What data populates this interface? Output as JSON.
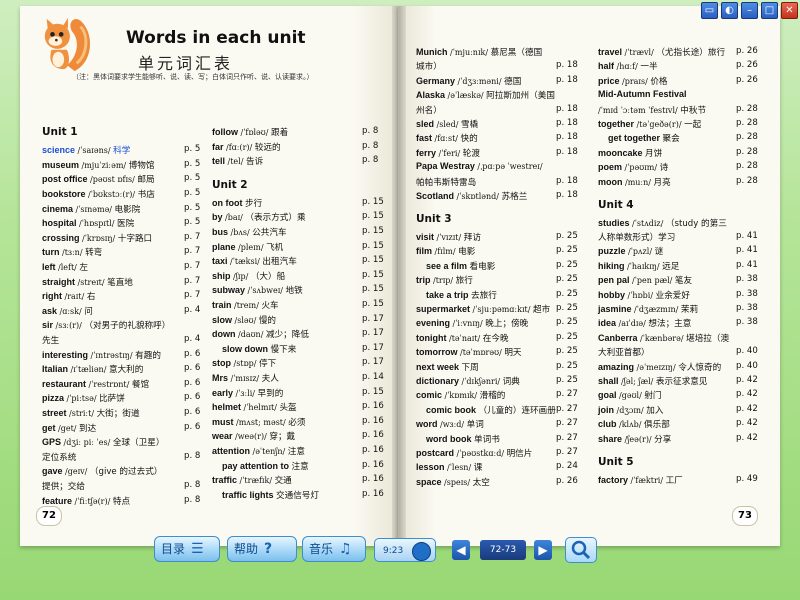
{
  "window_controls": [
    "▭",
    "◐",
    "–",
    "□",
    "✕"
  ],
  "book": {
    "title": "Words in each unit",
    "subtitle": "单元词汇表",
    "note": "（注：黑体词要求学生能够听、说、读、写；白体词只作听、说、认读要求。）",
    "page_left_number": "72",
    "page_right_number": "73"
  },
  "left_col1": [
    {
      "t": "unit",
      "en": "Unit 1"
    },
    {
      "en": "science",
      "ph": "/ˈsaɪəns/",
      "zh": "科学",
      "p": "p. 5",
      "blue": true
    },
    {
      "en": "museum",
      "ph": "/mjuˈziːəm/",
      "zh": "博物馆",
      "p": "p. 5"
    },
    {
      "en": "post office",
      "ph": "/pəʊst ɒfɪs/",
      "zh": "邮局",
      "p": "p. 5"
    },
    {
      "en": "bookstore",
      "ph": "/ˈbʊkstɔː(r)/",
      "zh": "书店",
      "p": "p. 5"
    },
    {
      "en": "cinema",
      "ph": "/ˈsɪnəmə/",
      "zh": "电影院",
      "p": "p. 5"
    },
    {
      "en": "hospital",
      "ph": "/ˈhɒspɪtl/",
      "zh": "医院",
      "p": "p. 5"
    },
    {
      "en": "crossing",
      "ph": "/ˈkrɒsɪŋ/",
      "zh": "十字路口",
      "p": "p. 7"
    },
    {
      "en": "turn",
      "ph": "/tɜːn/",
      "zh": "转弯",
      "p": "p. 7"
    },
    {
      "en": "left",
      "ph": "/left/",
      "zh": "左",
      "p": "p. 7"
    },
    {
      "en": "straight",
      "ph": "/streɪt/",
      "zh": "笔直地",
      "p": "p. 7"
    },
    {
      "en": "right",
      "ph": "/raɪt/",
      "zh": "右",
      "p": "p. 7"
    },
    {
      "en": "ask",
      "ph": "/ɑːsk/",
      "zh": "问",
      "p": "p. 4"
    },
    {
      "en": "sir",
      "ph": "/sɜː(r)/",
      "zh": "（对男子的礼貌称呼）",
      "p": ""
    },
    {
      "en": "",
      "ph": "",
      "zh": "先生",
      "p": "p. 4"
    },
    {
      "en": "interesting",
      "ph": "/ˈɪntrəstɪŋ/",
      "zh": "有趣的",
      "p": "p. 6"
    },
    {
      "en": "Italian",
      "ph": "/ɪˈtæliən/",
      "zh": "意大利的",
      "p": "p. 6"
    },
    {
      "en": "restaurant",
      "ph": "/ˈrestrɒnt/",
      "zh": "餐馆",
      "p": "p. 6"
    },
    {
      "en": "pizza",
      "ph": "/ˈpiːtsə/",
      "zh": "比萨饼",
      "p": "p. 6"
    },
    {
      "en": "street",
      "ph": "/striːt/",
      "zh": "大街；街道",
      "p": "p. 6"
    },
    {
      "en": "get",
      "ph": "/get/",
      "zh": "到达",
      "p": "p. 6"
    },
    {
      "en": "GPS",
      "ph": "/dʒiː piː ˈes/",
      "zh": "全球（卫星）",
      "p": ""
    },
    {
      "en": "",
      "ph": "",
      "zh": "定位系统",
      "p": "p. 8"
    },
    {
      "en": "gave",
      "ph": "/geɪv/",
      "zh": "（give 的过去式）",
      "p": ""
    },
    {
      "en": "",
      "ph": "",
      "zh": "提供；交给",
      "p": "p. 8"
    },
    {
      "en": "feature",
      "ph": "/ˈfiːtʃə(r)/",
      "zh": "特点",
      "p": "p. 8"
    }
  ],
  "left_col2": [
    {
      "en": "follow",
      "ph": "/ˈfɒləʊ/",
      "zh": "跟着",
      "p": "p. 8"
    },
    {
      "en": "far",
      "ph": "/fɑː(r)/",
      "zh": "较远的",
      "p": "p. 8"
    },
    {
      "en": "tell",
      "ph": "/tel/",
      "zh": "告诉",
      "p": "p. 8"
    },
    {
      "t": "gap"
    },
    {
      "t": "unit",
      "en": "Unit 2"
    },
    {
      "en": "on foot",
      "ph": "",
      "zh": "步行",
      "p": "p. 15"
    },
    {
      "en": "by",
      "ph": "/baɪ/",
      "zh": "（表示方式）乘",
      "p": "p. 15"
    },
    {
      "en": "bus",
      "ph": "/bʌs/",
      "zh": "公共汽车",
      "p": "p. 15"
    },
    {
      "en": "plane",
      "ph": "/pleɪn/",
      "zh": "飞机",
      "p": "p. 15"
    },
    {
      "en": "taxi",
      "ph": "/ˈtæksi/",
      "zh": "出租汽车",
      "p": "p. 15"
    },
    {
      "en": "ship",
      "ph": "/ʃɪp/",
      "zh": "（大）船",
      "p": "p. 15"
    },
    {
      "en": "subway",
      "ph": "/ˈsʌbweɪ/",
      "zh": "地铁",
      "p": "p. 15"
    },
    {
      "en": "train",
      "ph": "/treɪn/",
      "zh": "火车",
      "p": "p. 15"
    },
    {
      "en": "slow",
      "ph": "/sləʊ/",
      "zh": "慢的",
      "p": "p. 17"
    },
    {
      "en": "down",
      "ph": "/daʊn/",
      "zh": "减少；降低",
      "p": "p. 17"
    },
    {
      "en": "slow down",
      "ph": "",
      "zh": "慢下来",
      "p": "p. 17",
      "ind": true
    },
    {
      "en": "stop",
      "ph": "/stɒp/",
      "zh": "停下",
      "p": "p. 17"
    },
    {
      "en": "Mrs",
      "ph": "/ˈmɪsɪz/",
      "zh": "夫人",
      "p": "p. 14"
    },
    {
      "en": "early",
      "ph": "/ˈɜːli/",
      "zh": "早到的",
      "p": "p. 15"
    },
    {
      "en": "helmet",
      "ph": "/ˈhelmɪt/",
      "zh": "头盔",
      "p": "p. 16"
    },
    {
      "en": "must",
      "ph": "/mʌst; məst/",
      "zh": "必须",
      "p": "p. 16"
    },
    {
      "en": "wear",
      "ph": "/weə(r)/",
      "zh": "穿；戴",
      "p": "p. 16"
    },
    {
      "en": "attention",
      "ph": "/əˈtenʃn/",
      "zh": "注意",
      "p": "p. 16"
    },
    {
      "en": "pay attention to",
      "ph": "",
      "zh": "注意",
      "p": "p. 16",
      "ind": true
    },
    {
      "en": "traffic",
      "ph": "/ˈtræfɪk/",
      "zh": "交通",
      "p": "p. 16"
    },
    {
      "en": "traffic lights",
      "ph": "",
      "zh": "交通信号灯",
      "p": "p. 16",
      "ind": true
    }
  ],
  "right_col1": [
    {
      "en": "Munich",
      "ph": "/ˈmjuːnɪk/",
      "zh": "慕尼黑（德国",
      "p": ""
    },
    {
      "en": "",
      "ph": "",
      "zh": "城市）",
      "p": "p. 18"
    },
    {
      "en": "Germany",
      "ph": "/ˈdʒɜːməni/",
      "zh": "德国",
      "p": "p. 18"
    },
    {
      "en": "Alaska",
      "ph": "/əˈlæskə/",
      "zh": "阿拉斯加州（美国",
      "p": ""
    },
    {
      "en": "",
      "ph": "",
      "zh": "州名）",
      "p": "p. 18"
    },
    {
      "en": "sled",
      "ph": "/sled/",
      "zh": "雪橇",
      "p": "p. 18"
    },
    {
      "en": "fast",
      "ph": "/fɑːst/",
      "zh": "快的",
      "p": "p. 18"
    },
    {
      "en": "ferry",
      "ph": "/ˈferi/",
      "zh": "轮渡",
      "p": "p. 18"
    },
    {
      "en": "Papa Westray",
      "ph": "/ˌpɑːpə ˈwestreɪ/",
      "zh": "",
      "p": ""
    },
    {
      "en": "",
      "ph": "",
      "zh": "帕帕韦斯特雷岛",
      "p": "p. 18"
    },
    {
      "en": "Scotland",
      "ph": "/ˈskɒtlənd/",
      "zh": "苏格兰",
      "p": "p. 18"
    },
    {
      "t": "gap"
    },
    {
      "t": "unit",
      "en": "Unit 3"
    },
    {
      "en": "visit",
      "ph": "/ˈvɪzɪt/",
      "zh": "拜访",
      "p": "p. 25"
    },
    {
      "en": "film",
      "ph": "/fɪlm/",
      "zh": "电影",
      "p": "p. 25"
    },
    {
      "en": "see a film",
      "ph": "",
      "zh": "看电影",
      "p": "p. 25",
      "ind": true
    },
    {
      "en": "trip",
      "ph": "/trɪp/",
      "zh": "旅行",
      "p": "p. 25"
    },
    {
      "en": "take a trip",
      "ph": "",
      "zh": "去旅行",
      "p": "p. 25",
      "ind": true
    },
    {
      "en": "supermarket",
      "ph": "/ˈsjuːpəmɑːkɪt/",
      "zh": "超市",
      "p": "p. 25"
    },
    {
      "en": "evening",
      "ph": "/ˈiːvnɪŋ/",
      "zh": "晚上；傍晚",
      "p": "p. 25"
    },
    {
      "en": "tonight",
      "ph": "/təˈnaɪt/",
      "zh": "在今晚",
      "p": "p. 25"
    },
    {
      "en": "tomorrow",
      "ph": "/təˈmɒrəʊ/",
      "zh": "明天",
      "p": "p. 25"
    },
    {
      "en": "next week",
      "ph": "",
      "zh": "下周",
      "p": "p. 25"
    },
    {
      "en": "dictionary",
      "ph": "/ˈdɪkʃənri/",
      "zh": "词典",
      "p": "p. 25"
    },
    {
      "en": "comic",
      "ph": "/ˈkɒmɪk/",
      "zh": "滑稽的",
      "p": "p. 27"
    },
    {
      "en": "comic book",
      "ph": "",
      "zh": "（儿童的）连环画册",
      "p": "p. 27",
      "ind": true
    },
    {
      "en": "word",
      "ph": "/wɜːd/",
      "zh": "单词",
      "p": "p. 27"
    },
    {
      "en": "word book",
      "ph": "",
      "zh": "单词书",
      "p": "p. 27",
      "ind": true
    },
    {
      "en": "postcard",
      "ph": "/ˈpəʊstkɑːd/",
      "zh": "明信片",
      "p": "p. 27"
    },
    {
      "en": "lesson",
      "ph": "/ˈlesn/",
      "zh": "课",
      "p": "p. 24"
    },
    {
      "en": "space",
      "ph": "/speɪs/",
      "zh": "太空",
      "p": "p. 26"
    }
  ],
  "right_col2": [
    {
      "en": "travel",
      "ph": "/ˈtrævl/",
      "zh": "（尤指长途）旅行",
      "p": "p. 26"
    },
    {
      "en": "half",
      "ph": "/hɑːf/",
      "zh": "一半",
      "p": "p. 26"
    },
    {
      "en": "price",
      "ph": "/praɪs/",
      "zh": "价格",
      "p": "p. 26"
    },
    {
      "en": "Mid-Autumn Festival",
      "ph": "",
      "zh": "",
      "p": ""
    },
    {
      "en": "",
      "ph": "/ˈmɪd ˈɔːtəm ˈfestɪvl/",
      "zh": "中秋节",
      "p": "p. 28"
    },
    {
      "en": "together",
      "ph": "/təˈgeðə(r)/",
      "zh": "一起",
      "p": "p. 28"
    },
    {
      "en": "get together",
      "ph": "",
      "zh": "聚会",
      "p": "p. 28",
      "ind": true
    },
    {
      "en": "mooncake",
      "ph": "",
      "zh": "月饼",
      "p": "p. 28"
    },
    {
      "en": "poem",
      "ph": "/ˈpəʊɪm/",
      "zh": "诗",
      "p": "p. 28"
    },
    {
      "en": "moon",
      "ph": "/muːn/",
      "zh": "月亮",
      "p": "p. 28"
    },
    {
      "t": "gap"
    },
    {
      "t": "unit",
      "en": "Unit 4"
    },
    {
      "en": "studies",
      "ph": "/ˈstʌdiz/",
      "zh": "（study 的第三",
      "p": ""
    },
    {
      "en": "",
      "ph": "",
      "zh": "人称单数形式）学习",
      "p": "p. 41"
    },
    {
      "en": "puzzle",
      "ph": "/ˈpʌzl/",
      "zh": "谜",
      "p": "p. 41"
    },
    {
      "en": "hiking",
      "ph": "/ˈhaɪkɪŋ/",
      "zh": "远足",
      "p": "p. 41"
    },
    {
      "en": "pen pal",
      "ph": "/ˈpen pæl/",
      "zh": "笔友",
      "p": "p. 38"
    },
    {
      "en": "hobby",
      "ph": "/ˈhɒbi/",
      "zh": "业余爱好",
      "p": "p. 38"
    },
    {
      "en": "jasmine",
      "ph": "/ˈdʒæzmɪn/",
      "zh": "茉莉",
      "p": "p. 38"
    },
    {
      "en": "idea",
      "ph": "/aɪˈdɪə/",
      "zh": "想法；主意",
      "p": "p. 38"
    },
    {
      "en": "Canberra",
      "ph": "/ˈkænbərə/",
      "zh": "堪培拉（澳",
      "p": ""
    },
    {
      "en": "",
      "ph": "",
      "zh": "大利亚首都）",
      "p": "p. 40"
    },
    {
      "en": "amazing",
      "ph": "/əˈmeɪzɪŋ/",
      "zh": "令人惊奇的",
      "p": "p. 40"
    },
    {
      "en": "shall",
      "ph": "/ʃəl; ʃæl/",
      "zh": "表示征求意见",
      "p": "p. 42"
    },
    {
      "en": "goal",
      "ph": "/gəʊl/",
      "zh": "射门",
      "p": "p. 42"
    },
    {
      "en": "join",
      "ph": "/dʒɔɪn/",
      "zh": "加入",
      "p": "p. 42"
    },
    {
      "en": "club",
      "ph": "/klʌb/",
      "zh": "俱乐部",
      "p": "p. 42"
    },
    {
      "en": "share",
      "ph": "/ʃeə(r)/",
      "zh": "分享",
      "p": "p. 42"
    },
    {
      "t": "gap"
    },
    {
      "t": "unit",
      "en": "Unit 5"
    },
    {
      "en": "factory",
      "ph": "/ˈfæktri/",
      "zh": "工厂",
      "p": "p. 49"
    }
  ],
  "toolbar": {
    "contents_label": "目录",
    "contents_icon": "list-icon",
    "help_label": "帮助",
    "help_icon": "question-icon",
    "music_label": "音乐",
    "music_icon": "music-note-icon",
    "clock": "9:23",
    "prev_icon": "◀",
    "page_range": "72-73",
    "next_icon": "▶",
    "search_icon": "magnifier-icon"
  }
}
